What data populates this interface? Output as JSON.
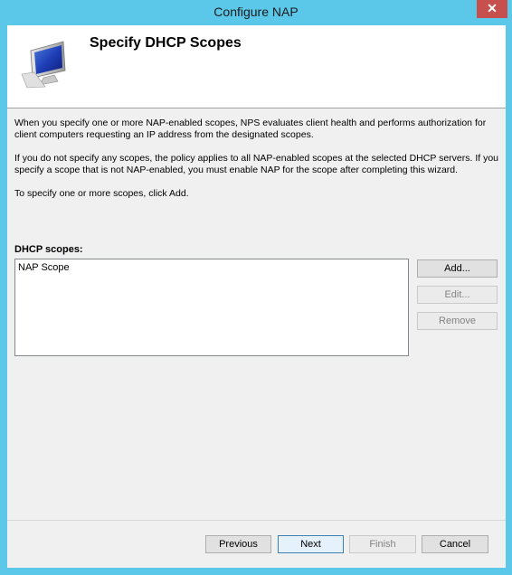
{
  "window": {
    "title": "Configure NAP",
    "close_glyph": "✕"
  },
  "header": {
    "title": "Specify DHCP Scopes",
    "icon": "computer-monitor-icon"
  },
  "body": {
    "para1": "When you specify one or more NAP-enabled scopes, NPS evaluates client health and performs authorization for client computers requesting an IP address from the designated scopes.",
    "para2": "If you do not specify any scopes, the policy applies to all NAP-enabled scopes at the selected DHCP servers. If you specify a scope that is not NAP-enabled, you must enable NAP for the scope after completing this wizard.",
    "para3": "To specify one or more scopes, click Add."
  },
  "scopes": {
    "label": "DHCP scopes:",
    "items": [
      "NAP Scope"
    ],
    "add_label": "Add...",
    "edit_label": "Edit...",
    "remove_label": "Remove"
  },
  "footer": {
    "previous_label": "Previous",
    "next_label": "Next",
    "finish_label": "Finish",
    "cancel_label": "Cancel"
  }
}
